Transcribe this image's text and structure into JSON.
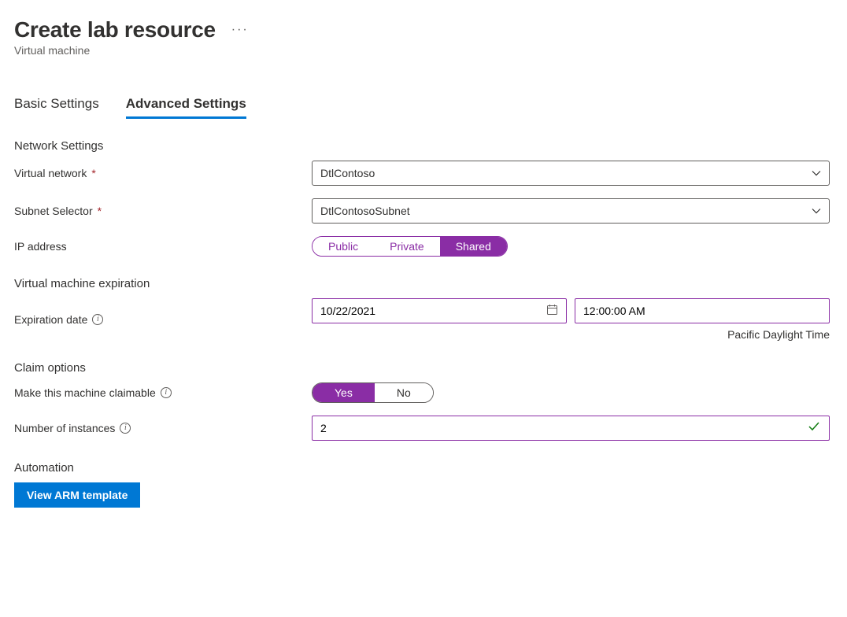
{
  "header": {
    "title": "Create lab resource",
    "subtitle": "Virtual machine"
  },
  "tabs": {
    "basic": "Basic Settings",
    "advanced": "Advanced Settings"
  },
  "sections": {
    "network": "Network Settings",
    "expiration": "Virtual machine expiration",
    "claim": "Claim options",
    "automation": "Automation"
  },
  "labels": {
    "virtual_network": "Virtual network",
    "subnet_selector": "Subnet Selector",
    "ip_address": "IP address",
    "expiration_date": "Expiration date",
    "make_claimable": "Make this machine claimable",
    "num_instances": "Number of instances"
  },
  "values": {
    "virtual_network": "DtlContoso",
    "subnet_selector": "DtlContosoSubnet",
    "expiration_date": "10/22/2021",
    "expiration_time": "12:00:00 AM",
    "timezone_note": "Pacific Daylight Time",
    "num_instances": "2"
  },
  "ip_options": {
    "public": "Public",
    "private": "Private",
    "shared": "Shared"
  },
  "claim_options": {
    "yes": "Yes",
    "no": "No"
  },
  "buttons": {
    "view_arm": "View ARM template"
  }
}
